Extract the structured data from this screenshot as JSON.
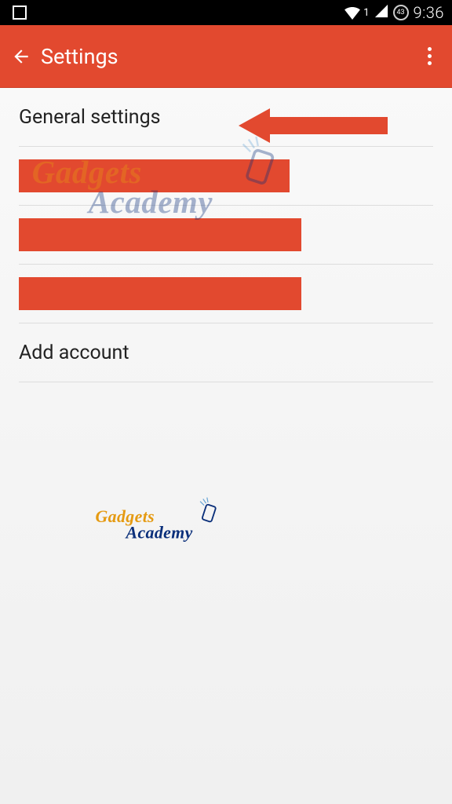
{
  "status": {
    "signal_num": "1",
    "battery_pct": "43",
    "clock": "9:36"
  },
  "appbar": {
    "title": "Settings"
  },
  "rows": {
    "general_settings": "General settings",
    "add_account": "Add account"
  },
  "watermark": {
    "line1": "Gadgets",
    "line2": "Academy"
  },
  "colors": {
    "primary": "#e2492f"
  }
}
